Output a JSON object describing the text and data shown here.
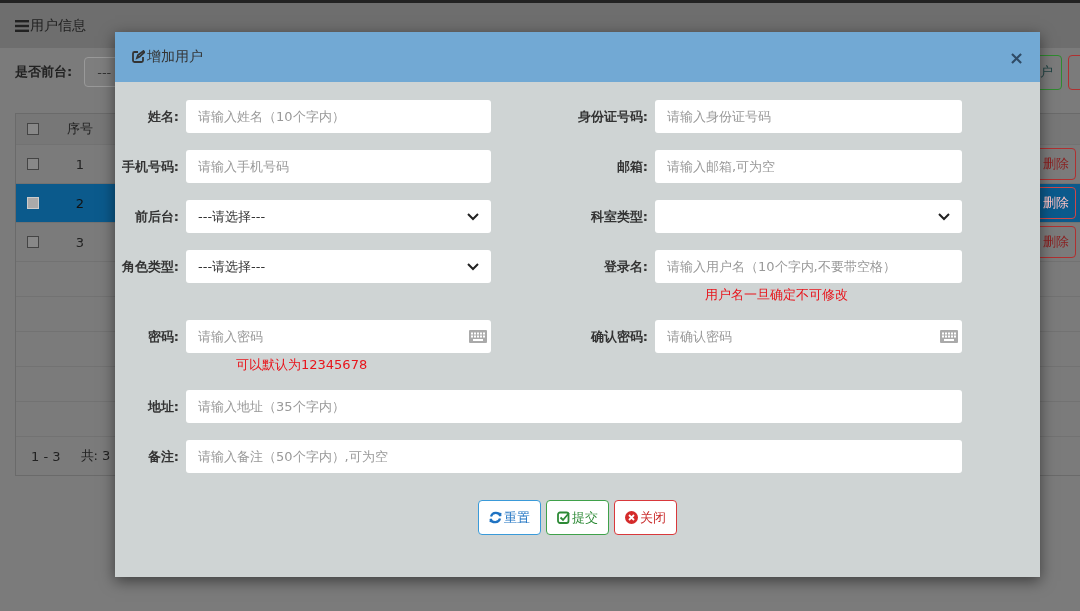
{
  "page": {
    "title": "用户信息",
    "filter_label": "是否前台:",
    "filter_value": "---",
    "toolbar_buttons": [
      {
        "label": "户",
        "kind": "add"
      },
      {
        "kind": "danger"
      }
    ]
  },
  "table": {
    "columns": [
      "序号"
    ],
    "header_checked": false,
    "rows": [
      {
        "index": "1",
        "selected": false,
        "checked": false,
        "action": "删除"
      },
      {
        "index": "2",
        "selected": true,
        "checked": false,
        "action": "删除"
      },
      {
        "index": "3",
        "selected": false,
        "checked": false,
        "action": "删除"
      }
    ],
    "range": "1 - 3",
    "total": "共: 3"
  },
  "dialog": {
    "title": "增加用户",
    "close": "×",
    "rows": [
      [
        {
          "label": "姓名:",
          "kind": "text",
          "placeholder": "请输入姓名（10个字内）"
        },
        {
          "label": "身份证号码:",
          "kind": "text",
          "placeholder": "请输入身份证号码"
        }
      ],
      [
        {
          "label": "手机号码:",
          "kind": "text",
          "placeholder": "请输入手机号码"
        },
        {
          "label": "邮箱:",
          "kind": "text",
          "placeholder": "请输入邮箱,可为空"
        }
      ],
      [
        {
          "label": "前后台:",
          "kind": "select",
          "value": "---请选择---"
        },
        {
          "label": "科室类型:",
          "kind": "select"
        }
      ],
      [
        {
          "label": "角色类型:",
          "kind": "select",
          "value": "---请选择---"
        },
        {
          "label": "登录名:",
          "kind": "text",
          "placeholder": "请输入用户名（10个字内,不要带空格）",
          "hint": "用户名一旦确定不可修改"
        }
      ],
      [
        {
          "label": "密码:",
          "kind": "password",
          "placeholder": "请输入密码",
          "hint": "可以默认为12345678"
        },
        {
          "label": "确认密码:",
          "kind": "password",
          "placeholder": "请确认密码"
        }
      ],
      [
        {
          "label": "地址:",
          "kind": "text",
          "placeholder": "请输入地址（35个字内）"
        }
      ],
      [
        {
          "label": "备注:",
          "kind": "text",
          "placeholder": "请输入备注（50个字内）,可为空"
        }
      ]
    ],
    "buttons": [
      {
        "label": "重置",
        "kind": "reset"
      },
      {
        "label": "提交",
        "kind": "submit"
      },
      {
        "label": "关闭",
        "kind": "close"
      }
    ]
  }
}
